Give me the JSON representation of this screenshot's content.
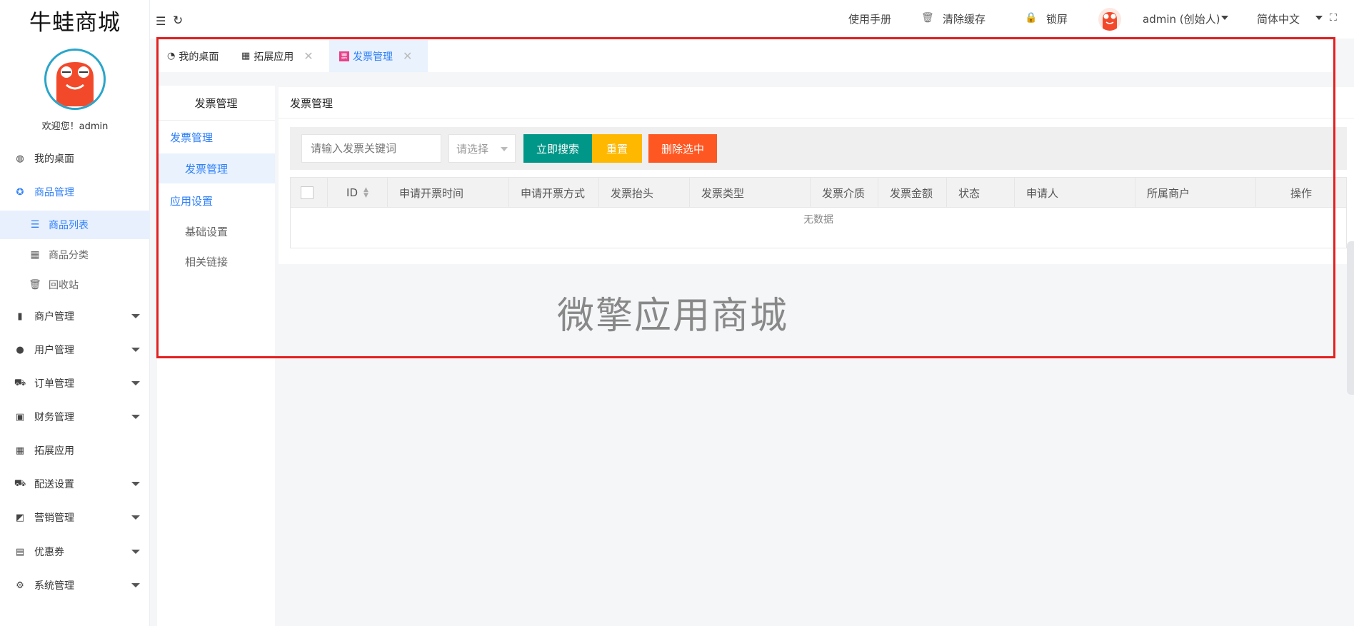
{
  "brand": "牛蛙商城",
  "welcome": "欢迎您！admin",
  "sidebar": {
    "items": [
      {
        "label": "我的桌面"
      },
      {
        "label": "商品管理"
      },
      {
        "label": "商户管理"
      },
      {
        "label": "用户管理"
      },
      {
        "label": "订单管理"
      },
      {
        "label": "财务管理"
      },
      {
        "label": "拓展应用"
      },
      {
        "label": "配送设置"
      },
      {
        "label": "营销管理"
      },
      {
        "label": "优惠券"
      },
      {
        "label": "系统管理"
      }
    ],
    "subitems": [
      {
        "label": "商品列表"
      },
      {
        "label": "商品分类"
      },
      {
        "label": "回收站"
      }
    ]
  },
  "header": {
    "manual": "使用手册",
    "clear_cache": "清除缓存",
    "lock": "锁屏",
    "user": "admin (创始人)",
    "language": "简体中文"
  },
  "tabs": [
    {
      "label": "我的桌面"
    },
    {
      "label": "拓展应用"
    },
    {
      "label": "发票管理"
    }
  ],
  "submenu": {
    "title": "发票管理",
    "groups": [
      {
        "label": "发票管理"
      },
      {
        "label": "发票管理"
      },
      {
        "label": "应用设置"
      },
      {
        "label": "基础设置"
      },
      {
        "label": "相关链接"
      }
    ]
  },
  "panel": {
    "title": "发票管理",
    "search_placeholder": "请输入发票关键词",
    "select_value": "请选择",
    "search_button": "立即搜索",
    "reset_button": "重置",
    "delete_button": "删除选中",
    "columns": [
      "ID",
      "申请开票时间",
      "申请开票方式",
      "发票抬头",
      "发票类型",
      "发票介质",
      "发票金额",
      "状态",
      "申请人",
      "所属商户",
      "操作"
    ],
    "empty_text": "无数据"
  },
  "watermark": "微擎应用商城",
  "colors": {
    "accent": "#2d7ff9",
    "search_btn": "#009688",
    "reset_btn": "#ffb800",
    "delete_btn": "#ff5722",
    "highlight": "#e32020"
  }
}
